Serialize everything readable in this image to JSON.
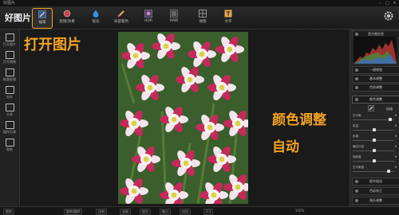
{
  "titlebar": {
    "title": "好图片"
  },
  "toolbar": {
    "logo": "好图片",
    "tools": [
      {
        "label": "编辑",
        "icon": "edit-icon"
      },
      {
        "label": "滤镜/效果",
        "icon": "filter-icon"
      },
      {
        "label": "锐化",
        "icon": "drop-icon"
      },
      {
        "label": "局部着色",
        "icon": "brush-icon"
      },
      {
        "label": "HDR",
        "icon": "hdr-icon"
      },
      {
        "label": "RAW",
        "icon": "raw-icon"
      },
      {
        "label": "拼图",
        "icon": "collage-icon"
      },
      {
        "label": "文字",
        "icon": "text-icon"
      }
    ]
  },
  "leftbar": {
    "items": [
      {
        "label": "打开图片",
        "icon": "folder-icon"
      },
      {
        "label": "打开视频",
        "icon": "video-icon"
      },
      {
        "label": "批量处理",
        "icon": "batch-icon"
      },
      {
        "label": "另存",
        "icon": "save-icon"
      },
      {
        "label": "分享",
        "icon": "share-icon"
      },
      {
        "label": "操作记录",
        "icon": "history-icon"
      },
      {
        "label": "帮助",
        "icon": "help-icon"
      }
    ]
  },
  "annotations": {
    "open_image": "打开图片",
    "color_adjust": "颜色调整",
    "auto": "自动"
  },
  "rightpanel": {
    "histogram_title": "直方图信息",
    "sections": [
      {
        "label": "一键增强"
      },
      {
        "label": "基本调整"
      },
      {
        "label": "色阶调整"
      },
      {
        "label": "颜色调整"
      }
    ],
    "auto_label": "自动",
    "sliders": [
      {
        "label": "白平衡",
        "value": "0",
        "knob": 0.9
      },
      {
        "label": "色温",
        "value": "0",
        "knob": 0.5
      },
      {
        "label": "色调",
        "value": "0",
        "knob": 0.5
      },
      {
        "label": "曝光补偿",
        "value": "0",
        "knob": 0.5
      },
      {
        "label": "饱和度",
        "value": "0",
        "knob": 0.5
      },
      {
        "label": "白平衡值",
        "value": "0",
        "knob": 0.85
      }
    ],
    "bottom_sections": [
      {
        "label": "细节锐化"
      },
      {
        "label": "色彩校正"
      },
      {
        "label": "镜头调整"
      }
    ]
  },
  "statusbar": {
    "left_label": "裁剪",
    "buttons": [
      "旋转/翻转",
      "比例",
      "全屏",
      "放大",
      "缩小",
      "对比",
      "1:1"
    ],
    "zoom": "100%"
  },
  "colors": {
    "accent": "#f3a324",
    "background": "#1e1e1e",
    "panel": "#262626"
  }
}
